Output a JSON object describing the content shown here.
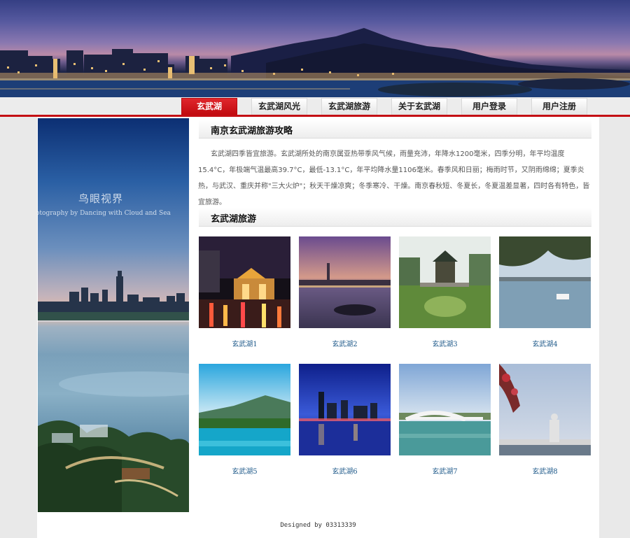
{
  "nav": {
    "items": [
      {
        "label": "玄武湖",
        "active": true
      },
      {
        "label": "玄武湖风光",
        "active": false
      },
      {
        "label": "玄武湖旅游",
        "active": false
      },
      {
        "label": "关于玄武湖",
        "active": false
      },
      {
        "label": "用户登录",
        "active": false
      },
      {
        "label": "用户注册",
        "active": false
      }
    ]
  },
  "sidebar": {
    "watermark_main": "鸟眼视界",
    "watermark_sub": "otography by Dancing with Cloud and Sea"
  },
  "guide": {
    "title": "南京玄武湖旅游攻略",
    "text": "玄武湖四季皆宜旅游。玄武湖所处的南京属亚热带季风气候，雨量充沛，年降水1200毫米，四季分明，年平均温度15.4°C，年极端气温最高39.7°C，最低-13.1°C，年平均降水量1106毫米。春季风和日丽；梅雨时节，又阴雨绵绵；夏季炎热，与武汉、重庆并称\"三大火炉\"；秋天干燥凉爽；冬季寒冷、干燥。南京春秋短、冬夏长，冬夏温差显著，四时各有特色，皆宜旅游。"
  },
  "tourism": {
    "title": "玄武湖旅游",
    "photos": [
      {
        "caption": "玄武湖1"
      },
      {
        "caption": "玄武湖2"
      },
      {
        "caption": "玄武湖3"
      },
      {
        "caption": "玄武湖4"
      },
      {
        "caption": "玄武湖5"
      },
      {
        "caption": "玄武湖6"
      },
      {
        "caption": "玄武湖7"
      },
      {
        "caption": "玄武湖8"
      }
    ]
  },
  "footer": {
    "text": "Designed by 03313339"
  },
  "colors": {
    "accent": "#c40f14",
    "link": "#1f5a8a"
  }
}
